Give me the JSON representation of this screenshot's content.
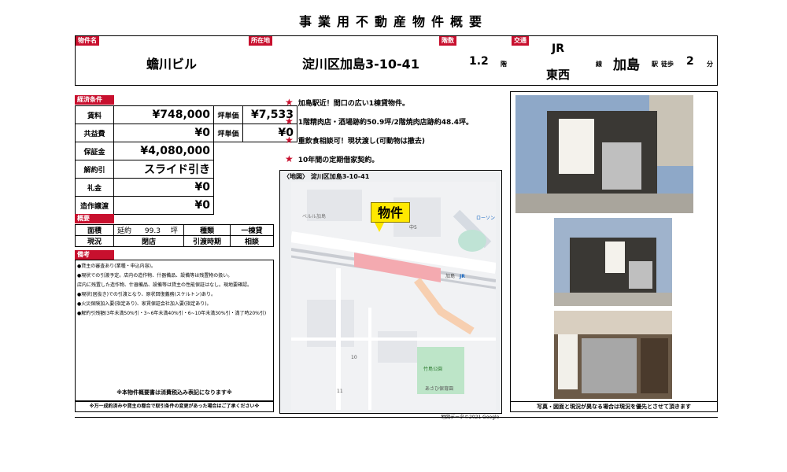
{
  "title": "事業用不動産物件概要",
  "header": {
    "name_label": "物件名",
    "name": "蟾川ビル",
    "addr_label": "所在地",
    "address": "淀川区加島3-10-41",
    "floor_label": "階数",
    "floors": "1.2",
    "floor_unit": "階",
    "transit_label": "交通",
    "line_top": "JR",
    "line_bottom": "東西",
    "line_suffix": "線",
    "station": "加島",
    "station_suffix": "駅",
    "walk_label": "徒歩",
    "walk": "2",
    "walk_unit": "分"
  },
  "econ": {
    "section_label": "経済条件",
    "rows": [
      {
        "label": "賃料",
        "value": "¥748,000",
        "label2": "坪単価",
        "value2": "¥7,533"
      },
      {
        "label": "共益費",
        "value": "¥0",
        "label2": "坪単価",
        "value2": "¥0"
      },
      {
        "label": "保証金",
        "value": "¥4,080,000"
      },
      {
        "label": "解約引",
        "value": "スライド引き"
      },
      {
        "label": "礼金",
        "value": "¥0"
      },
      {
        "label": "造作譲渡",
        "value": "¥0"
      }
    ]
  },
  "overview": {
    "section_label": "概要",
    "area_label": "面積",
    "area_prefix": "延約",
    "area_value": "99.3",
    "area_unit": "坪",
    "type_label": "種類",
    "type_value": "一棟貸",
    "status_label": "現況",
    "status_value": "閉店",
    "handover_label": "引渡時期",
    "handover_value": "相談"
  },
  "remarks": {
    "section_label": "備考",
    "lines": [
      "●貸主の審査あり(業種・申込内容)。",
      "●現状での引渡予定。店内の造作物、什器備品、設備等は残置物の扱い。",
      "店内に残置した造作物、什器備品、設備等は貸主の性能保証はなし。現地要確認。",
      "●現状(居抜き)での引渡となり、原状回復義務(スケルトン)あり。",
      "●火災保険加入要(指定あり)、家賃保証会社加入要(指定あり)。",
      "●解約引残額(3年未満50%引・3~6年未満40%引・6~10年未満30%引・満了時20%引)"
    ],
    "tax_note": "※本物件概要書は消費税込み表記になります※"
  },
  "footer_left": "※万一成約済みや貸主の都合で取引条件の変更があった場合はご了承ください※",
  "features": [
    "加島駅近！間口の広い1棟貸物件。",
    "1階精肉店・酒場跡約50.9坪/2階焼肉店跡約48.4坪。",
    "重飲食相談可！現状渡し(可動物は撤去)",
    "10年間の定期借家契約。"
  ],
  "map": {
    "caption": "〈地図〉 淀川区加島3-10-41",
    "callout": "物件",
    "credit": "地図データ©2021 Google",
    "labels": [
      "ベルル加島",
      "中5",
      "加島",
      "JR",
      "ローソン",
      "10",
      "11",
      "竹島公園",
      "あさひ保育園"
    ]
  },
  "photos_caption": "写真・図面と現況が異なる場合は現況を優先とさせて頂きます",
  "colors": {
    "accent": "#c8102e",
    "callout": "#ffe800"
  }
}
